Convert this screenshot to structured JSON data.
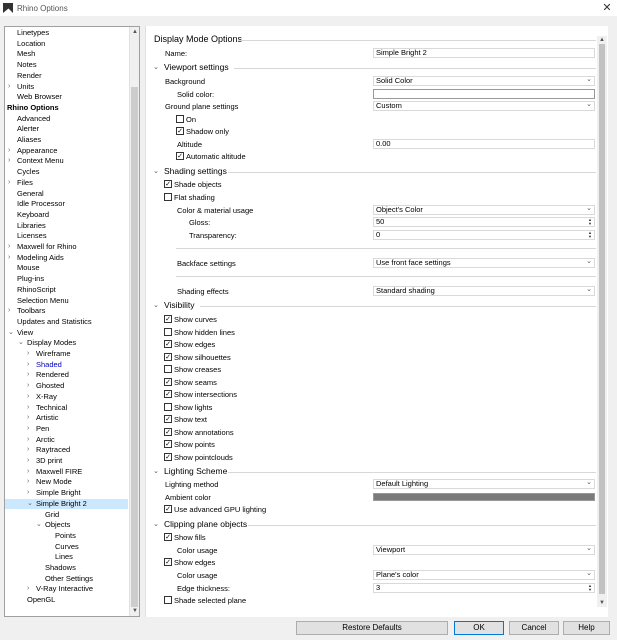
{
  "window": {
    "title": "Rhino Options",
    "close": "✕"
  },
  "tree": [
    {
      "label": "Linetypes",
      "level": 1,
      "arrow": ""
    },
    {
      "label": "Location",
      "level": 1,
      "arrow": ""
    },
    {
      "label": "Mesh",
      "level": 1,
      "arrow": ""
    },
    {
      "label": "Notes",
      "level": 1,
      "arrow": ""
    },
    {
      "label": "Render",
      "level": 1,
      "arrow": ""
    },
    {
      "label": "Units",
      "level": 1,
      "arrow": "›"
    },
    {
      "label": "Web Browser",
      "level": 1,
      "arrow": ""
    },
    {
      "label": "Rhino Options",
      "level": 0,
      "arrow": "",
      "bold": true
    },
    {
      "label": "Advanced",
      "level": 1,
      "arrow": ""
    },
    {
      "label": "Alerter",
      "level": 1,
      "arrow": ""
    },
    {
      "label": "Aliases",
      "level": 1,
      "arrow": ""
    },
    {
      "label": "Appearance",
      "level": 1,
      "arrow": "›"
    },
    {
      "label": "Context Menu",
      "level": 1,
      "arrow": "›"
    },
    {
      "label": "Cycles",
      "level": 1,
      "arrow": ""
    },
    {
      "label": "Files",
      "level": 1,
      "arrow": "›"
    },
    {
      "label": "General",
      "level": 1,
      "arrow": ""
    },
    {
      "label": "Idle Processor",
      "level": 1,
      "arrow": ""
    },
    {
      "label": "Keyboard",
      "level": 1,
      "arrow": ""
    },
    {
      "label": "Libraries",
      "level": 1,
      "arrow": ""
    },
    {
      "label": "Licenses",
      "level": 1,
      "arrow": ""
    },
    {
      "label": "Maxwell for Rhino",
      "level": 1,
      "arrow": "›"
    },
    {
      "label": "Modeling Aids",
      "level": 1,
      "arrow": "›"
    },
    {
      "label": "Mouse",
      "level": 1,
      "arrow": ""
    },
    {
      "label": "Plug-ins",
      "level": 1,
      "arrow": ""
    },
    {
      "label": "RhinoScript",
      "level": 1,
      "arrow": ""
    },
    {
      "label": "Selection Menu",
      "level": 1,
      "arrow": ""
    },
    {
      "label": "Toolbars",
      "level": 1,
      "arrow": "›"
    },
    {
      "label": "Updates and Statistics",
      "level": 1,
      "arrow": ""
    },
    {
      "label": "View",
      "level": 1,
      "arrow": "⌄"
    },
    {
      "label": "Display Modes",
      "level": 2,
      "arrow": "⌄"
    },
    {
      "label": "Wireframe",
      "level": 3,
      "arrow": "›"
    },
    {
      "label": "Shaded",
      "level": 3,
      "arrow": "›",
      "blue": true
    },
    {
      "label": "Rendered",
      "level": 3,
      "arrow": "›"
    },
    {
      "label": "Ghosted",
      "level": 3,
      "arrow": "›"
    },
    {
      "label": "X-Ray",
      "level": 3,
      "arrow": "›"
    },
    {
      "label": "Technical",
      "level": 3,
      "arrow": "›"
    },
    {
      "label": "Artistic",
      "level": 3,
      "arrow": "›"
    },
    {
      "label": "Pen",
      "level": 3,
      "arrow": "›"
    },
    {
      "label": "Arctic",
      "level": 3,
      "arrow": "›"
    },
    {
      "label": "Raytraced",
      "level": 3,
      "arrow": "›"
    },
    {
      "label": "3D print",
      "level": 3,
      "arrow": "›"
    },
    {
      "label": "Maxwell FIRE",
      "level": 3,
      "arrow": "›"
    },
    {
      "label": "New Mode",
      "level": 3,
      "arrow": "›"
    },
    {
      "label": "Simple Bright",
      "level": 3,
      "arrow": "›"
    },
    {
      "label": "Simple Bright 2",
      "level": 3,
      "arrow": "⌄",
      "selected": true
    },
    {
      "label": "Grid",
      "level": 4,
      "arrow": ""
    },
    {
      "label": "Objects",
      "level": 4,
      "arrow": "⌄"
    },
    {
      "label": "Points",
      "level": 5,
      "arrow": ""
    },
    {
      "label": "Curves",
      "level": 5,
      "arrow": ""
    },
    {
      "label": "Lines",
      "level": 5,
      "arrow": ""
    },
    {
      "label": "Shadows",
      "level": 4,
      "arrow": ""
    },
    {
      "label": "Other Settings",
      "level": 4,
      "arrow": ""
    },
    {
      "label": "V-Ray Interactive",
      "level": 3,
      "arrow": "›"
    },
    {
      "label": "OpenGL",
      "level": 2,
      "arrow": ""
    }
  ],
  "panel": {
    "heading": "Display Mode Options",
    "name_label": "Name:",
    "name_value": "Simple Bright 2",
    "viewport": {
      "title": "Viewport settings",
      "collapse": "⌄",
      "background_label": "Background",
      "background_value": "Solid Color",
      "solid_color_label": "Solid color:",
      "ground_label": "Ground plane settings",
      "ground_value": "Custom",
      "on_label": "On",
      "shadow_only_label": "Shadow only",
      "altitude_label": "Altitude",
      "altitude_value": "0.00",
      "auto_alt_label": "Automatic altitude"
    },
    "shading": {
      "title": "Shading settings",
      "collapse": "⌄",
      "shade_label": "Shade objects",
      "flat_label": "Flat shading",
      "color_usage_label": "Color & material usage",
      "color_usage_value": "Object's Color",
      "gloss_label": "Gloss:",
      "gloss_value": "50",
      "transparency_label": "Transparency:",
      "transparency_value": "0",
      "backface_label": "Backface settings",
      "backface_value": "Use front face settings",
      "effects_label": "Shading effects",
      "effects_value": "Standard shading"
    },
    "visibility": {
      "title": "Visibility",
      "collapse": "⌄",
      "items": [
        {
          "label": "Show curves",
          "checked": true
        },
        {
          "label": "Show hidden lines",
          "checked": false
        },
        {
          "label": "Show edges",
          "checked": true
        },
        {
          "label": "Show silhouettes",
          "checked": true
        },
        {
          "label": "Show creases",
          "checked": false
        },
        {
          "label": "Show seams",
          "checked": true
        },
        {
          "label": "Show intersections",
          "checked": true
        },
        {
          "label": "Show lights",
          "checked": false
        },
        {
          "label": "Show text",
          "checked": true
        },
        {
          "label": "Show annotations",
          "checked": true
        },
        {
          "label": "Show points",
          "checked": true
        },
        {
          "label": "Show pointclouds",
          "checked": true
        }
      ]
    },
    "lighting": {
      "title": "Lighting Scheme",
      "collapse": "⌄",
      "method_label": "Lighting method",
      "method_value": "Default Lighting",
      "ambient_label": "Ambient color",
      "ambient_color": "#7a7a7a",
      "gpu_label": "Use advanced GPU lighting"
    },
    "clipping": {
      "title": "Clipping plane objects",
      "collapse": "⌄",
      "fills_label": "Show fills",
      "fill_color_label": "Color usage",
      "fill_color_value": "Viewport",
      "edges_label": "Show edges",
      "edge_color_label": "Color usage",
      "edge_color_value": "Plane's color",
      "thickness_label": "Edge thickness:",
      "thickness_value": "3",
      "shade_plane_label": "Shade selected plane"
    }
  },
  "buttons": {
    "restore": "Restore Defaults",
    "ok": "OK",
    "cancel": "Cancel",
    "help": "Help"
  },
  "check_glyph": "✓"
}
